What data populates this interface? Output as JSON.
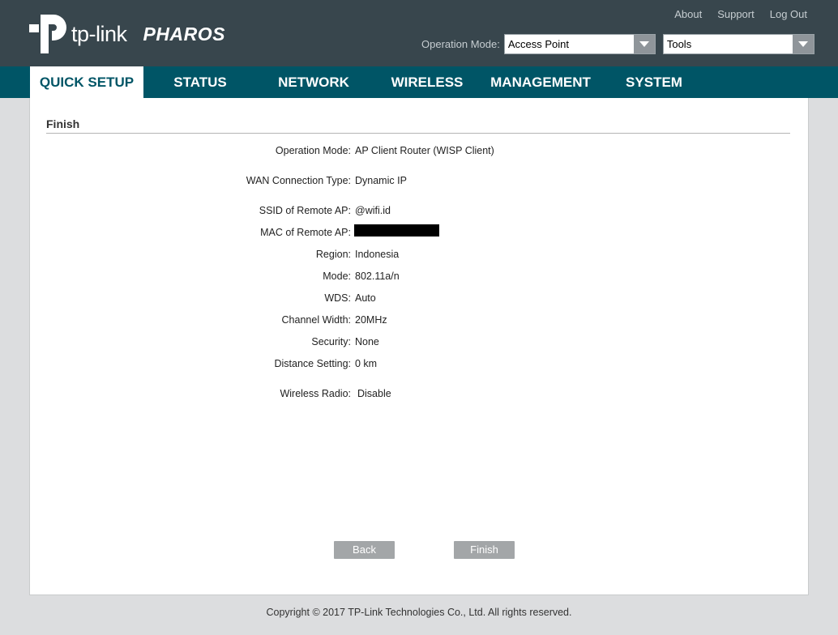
{
  "brand": {
    "logo_word": "tp-link",
    "product": "PHAROS"
  },
  "top_links": [
    "About",
    "Support",
    "Log Out"
  ],
  "operation_mode": {
    "label": "Operation Mode:",
    "value": "Access Point"
  },
  "tools_select": {
    "value": "Tools"
  },
  "nav": {
    "tabs": [
      {
        "label": "QUICK SETUP",
        "active": true
      },
      {
        "label": "STATUS"
      },
      {
        "label": "NETWORK"
      },
      {
        "label": "WIRELESS"
      },
      {
        "label": "MANAGEMENT"
      },
      {
        "label": "SYSTEM"
      }
    ]
  },
  "section": {
    "title": "Finish"
  },
  "summary": [
    {
      "label": "Operation Mode:",
      "value": "AP Client Router (WISP Client)"
    },
    {
      "label": "WAN Connection Type:",
      "value": "Dynamic IP"
    },
    {
      "label": "SSID of Remote AP:",
      "value": "@wifi.id"
    },
    {
      "label": "MAC of Remote AP:",
      "value": ""
    },
    {
      "label": "Region:",
      "value": "Indonesia"
    },
    {
      "label": "Mode:",
      "value": "802.11a/n"
    },
    {
      "label": "WDS:",
      "value": "Auto"
    },
    {
      "label": "Channel Width:",
      "value": "20MHz"
    },
    {
      "label": "Security:",
      "value": "None"
    },
    {
      "label": "Distance Setting:",
      "value": "0 km"
    },
    {
      "label": "Wireless Radio:",
      "value": "Disable"
    }
  ],
  "buttons": {
    "back": "Back",
    "finish": "Finish"
  },
  "footer": {
    "copyright": "Copyright © 2017 TP-Link Technologies Co., Ltd. All rights reserved."
  },
  "colors": {
    "header": "#38464d",
    "nav": "#005566",
    "button": "#a3a6a8"
  }
}
